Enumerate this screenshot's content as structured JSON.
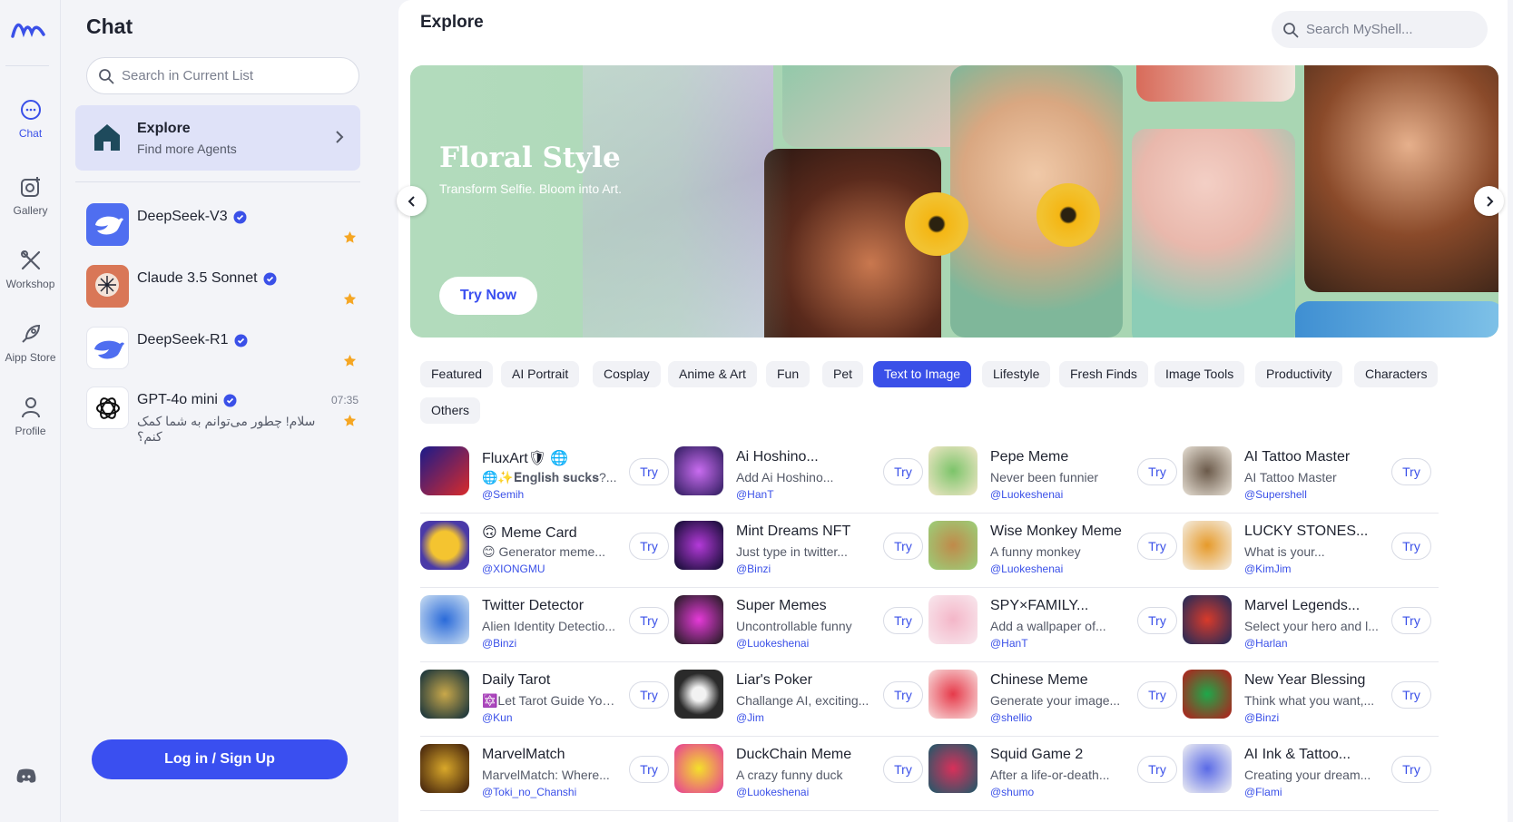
{
  "rail": {
    "items": [
      {
        "label": "Chat",
        "icon": "chat-icon"
      },
      {
        "label": "Gallery",
        "icon": "gallery-icon"
      },
      {
        "label": "Workshop",
        "icon": "workshop-icon"
      },
      {
        "label": "Aipp Store",
        "icon": "rocket-icon"
      },
      {
        "label": "Profile",
        "icon": "profile-icon"
      }
    ],
    "accent": "#3a50e8"
  },
  "chat": {
    "title": "Chat",
    "search_placeholder": "Search in Current List",
    "explore": {
      "title": "Explore",
      "subtitle": "Find more Agents"
    },
    "agents": [
      {
        "name": "DeepSeek-V3",
        "sub": "",
        "time": ""
      },
      {
        "name": "Claude 3.5 Sonnet",
        "sub": "",
        "time": ""
      },
      {
        "name": "DeepSeek-R1",
        "sub": "",
        "time": ""
      },
      {
        "name": "GPT-4o mini",
        "sub": "سلام! چطور می‌توانم به شما کمک کنم؟",
        "time": "07:35"
      }
    ],
    "login_label": "Log in / Sign Up"
  },
  "main": {
    "title": "Explore",
    "search_placeholder": "Search MyShell...",
    "banner": {
      "title": "Floral Style",
      "tagline": "Transform Selfie. Bloom into Art.",
      "cta": "Try Now"
    },
    "categories": [
      "Featured",
      "AI Portrait",
      "Cosplay",
      "Anime & Art",
      "Fun",
      "Pet",
      "Text to Image",
      "Lifestyle",
      "Fresh Finds",
      "Image Tools",
      "Productivity",
      "Characters",
      "Others"
    ],
    "active_category": "Text to Image",
    "try_label": "Try",
    "cards": [
      {
        "name": "FluxArt🛡 🌐",
        "desc": "🌐✨𝐄𝐧𝐠𝐥𝐢𝐬𝐡 𝐬𝐮𝐜𝐤𝐬?...",
        "author": "@Semih"
      },
      {
        "name": "Ai Hoshino...",
        "desc": "Add Ai Hoshino...",
        "author": "@HanT"
      },
      {
        "name": "Pepe Meme",
        "desc": "Never been funnier",
        "author": "@Luokeshenai"
      },
      {
        "name": "AI Tattoo Master",
        "desc": "AI Tattoo Master",
        "author": "@Supershell"
      },
      {
        "name": "🙃 Meme Card",
        "desc": "😊 Generator meme...",
        "author": "@XIONGMU"
      },
      {
        "name": "Mint Dreams NFT",
        "desc": "Just type in twitter...",
        "author": "@Binzi"
      },
      {
        "name": "Wise Monkey Meme",
        "desc": "A funny monkey",
        "author": "@Luokeshenai"
      },
      {
        "name": "LUCKY STONES...",
        "desc": "What is your...",
        "author": "@KimJim"
      },
      {
        "name": "Twitter Detector",
        "desc": "Alien Identity Detectio...",
        "author": "@Binzi"
      },
      {
        "name": "Super Memes",
        "desc": "Uncontrollable funny",
        "author": "@Luokeshenai"
      },
      {
        "name": "SPY×FAMILY...",
        "desc": "Add a wallpaper of...",
        "author": "@HanT"
      },
      {
        "name": "Marvel Legends...",
        "desc": "Select your hero and l...",
        "author": "@Harlan"
      },
      {
        "name": "Daily Tarot",
        "desc": "🔯Let Tarot Guide You...",
        "author": "@Kun"
      },
      {
        "name": "Liar's Poker",
        "desc": "Challange AI, exciting...",
        "author": "@Jim"
      },
      {
        "name": "Chinese Meme",
        "desc": "Generate your image...",
        "author": "@shellio"
      },
      {
        "name": "New Year Blessing",
        "desc": "Think what you want,...",
        "author": "@Binzi"
      },
      {
        "name": "MarvelMatch",
        "desc": "MarvelMatch: Where...",
        "author": "@Toki_no_Chanshi"
      },
      {
        "name": "DuckChain Meme",
        "desc": "A crazy funny duck",
        "author": "@Luokeshenai"
      },
      {
        "name": "Squid Game 2",
        "desc": "After a life-or-death...",
        "author": "@shumo"
      },
      {
        "name": "AI Ink & Tattoo...",
        "desc": "Creating your dream...",
        "author": "@Flami"
      }
    ]
  }
}
